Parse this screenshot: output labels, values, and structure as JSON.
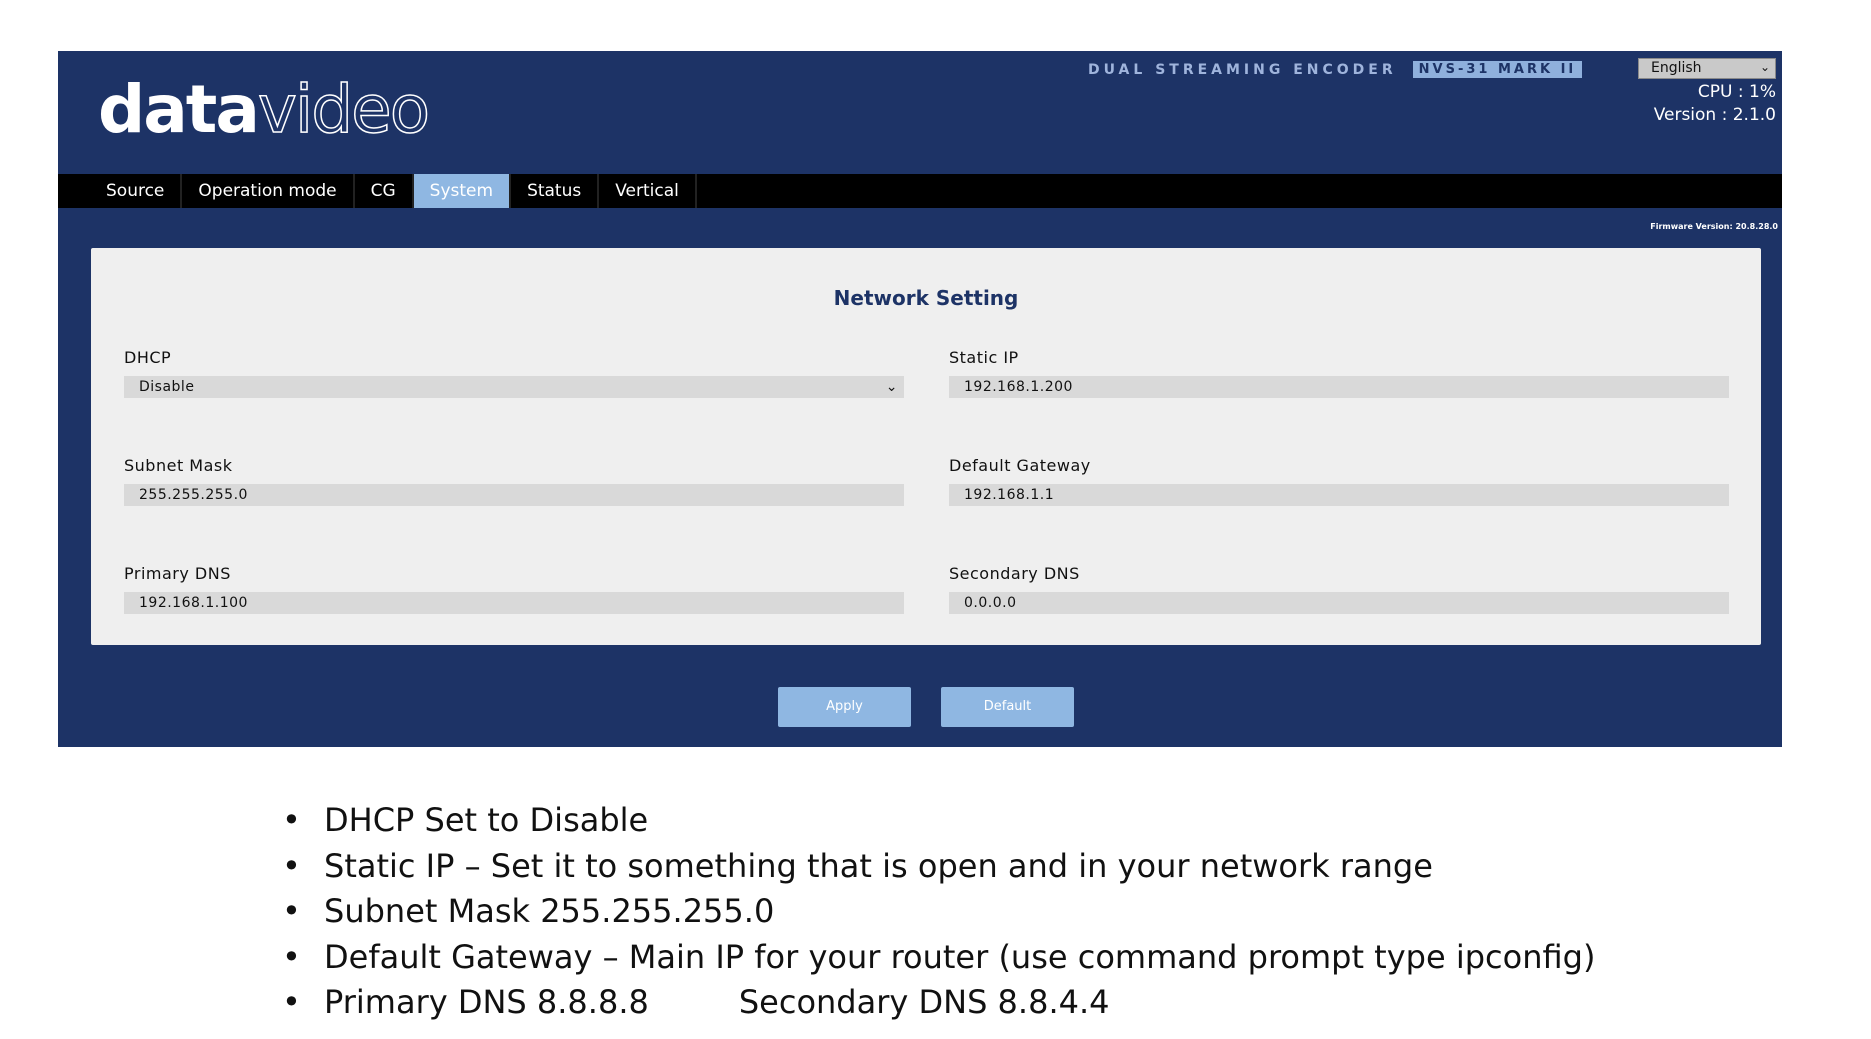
{
  "header": {
    "logo_part1": "data",
    "logo_part2": "video",
    "product_title": "DUAL STREAMING ENCODER",
    "model": "NVS-31 MARK II",
    "language": "English",
    "cpu": "CPU  : 1%",
    "version": "Version : 2.1.0",
    "firmware": "Firmware Version: 20.8.28.0"
  },
  "tabs": [
    {
      "label": "Source",
      "active": false
    },
    {
      "label": "Operation mode",
      "active": false
    },
    {
      "label": "CG",
      "active": false
    },
    {
      "label": "System",
      "active": true
    },
    {
      "label": "Status",
      "active": false
    },
    {
      "label": "Vertical",
      "active": false
    }
  ],
  "network": {
    "title": "Network Setting",
    "dhcp_label": "DHCP",
    "dhcp_value": "Disable",
    "static_ip_label": "Static IP",
    "static_ip_value": "192.168.1.200",
    "subnet_label": "Subnet Mask",
    "subnet_value": "255.255.255.0",
    "gateway_label": "Default Gateway",
    "gateway_value": "192.168.1.1",
    "primary_dns_label": "Primary DNS",
    "primary_dns_value": "192.168.1.100",
    "secondary_dns_label": "Secondary DNS",
    "secondary_dns_value": "0.0.0.0"
  },
  "buttons": {
    "apply": "Apply",
    "default": "Default"
  },
  "notes": {
    "item1": "DHCP Set to Disable",
    "item2": "Static IP – Set it to something that is open and in your network range",
    "item3": "Subnet Mask 255.255.255.0",
    "item4": "Default Gateway – Main IP for your router (use command prompt type ipconfig)",
    "item5a": "Primary DNS 8.8.8.8",
    "item5b": "Secondary DNS 8.8.4.4"
  },
  "colors": {
    "background": "#1d3366",
    "accent": "#8fb7e2",
    "panel": "#efefef"
  }
}
